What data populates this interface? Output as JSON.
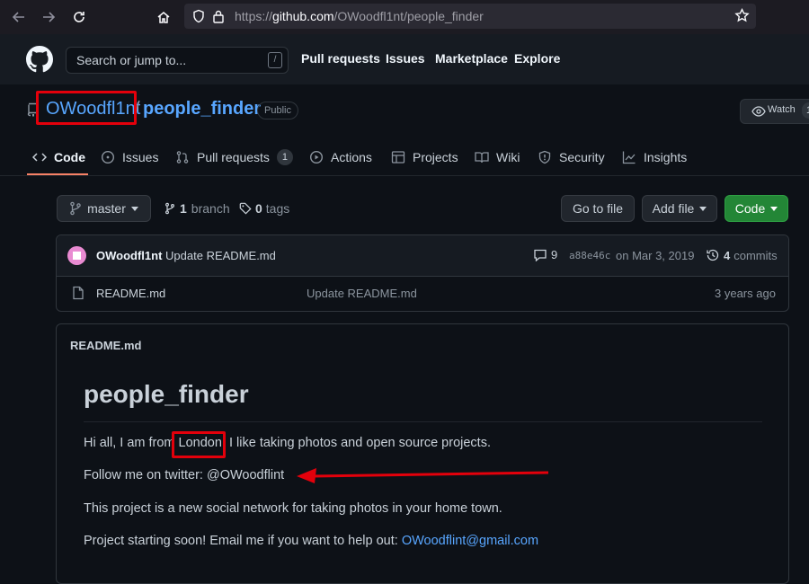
{
  "browser": {
    "url_prefix": "https://",
    "url_domain": "github.com",
    "url_path": "/OWoodfl1nt/people_finder"
  },
  "header": {
    "search_placeholder": "Search or jump to...",
    "slash_key": "/",
    "nav": [
      "Pull requests",
      "Issues",
      "Marketplace",
      "Explore"
    ]
  },
  "repo": {
    "owner": "OWoodfl1nt",
    "separator": "/",
    "name": "people_finder",
    "visibility": "Public",
    "watch_label": "Watch",
    "watch_count": "1"
  },
  "tabs": [
    {
      "label": "Code",
      "icon": "code-icon"
    },
    {
      "label": "Issues",
      "icon": "issue-icon"
    },
    {
      "label": "Pull requests",
      "icon": "pull-request-icon",
      "count": "1"
    },
    {
      "label": "Actions",
      "icon": "play-icon"
    },
    {
      "label": "Projects",
      "icon": "table-icon"
    },
    {
      "label": "Wiki",
      "icon": "book-icon"
    },
    {
      "label": "Security",
      "icon": "shield-icon"
    },
    {
      "label": "Insights",
      "icon": "graph-icon"
    }
  ],
  "toolbar": {
    "branch": "master",
    "branch_count": "1",
    "branch_label": "branch",
    "tag_count": "0",
    "tag_label": "tags",
    "goto_file": "Go to file",
    "add_file": "Add file",
    "code": "Code"
  },
  "commit": {
    "author": "OWoodfl1nt",
    "message": "Update README.md",
    "comments": "9",
    "sha": "a88e46c",
    "date": "on Mar 3, 2019",
    "commit_count": "4",
    "commit_label": "commits"
  },
  "files": [
    {
      "name": "README.md",
      "message": "Update README.md",
      "age": "3 years ago"
    }
  ],
  "readme": {
    "filename": "README.md",
    "heading": "people_finder",
    "p1_before": "Hi all, I am from",
    "p1_location": "London",
    "p1_after": ". I like taking photos and open source projects.",
    "p2": "Follow me on twitter: @OWoodflint",
    "p3": "This project is a new social network for taking photos in your home town.",
    "p4_text": "Project starting soon! Email me if you want to help out:",
    "p4_email": "OWoodflint@gmail.com"
  },
  "colors": {
    "background": "#0d1117",
    "link": "#58a6ff",
    "highlight": "#e3000b",
    "code_button": "#238636"
  }
}
